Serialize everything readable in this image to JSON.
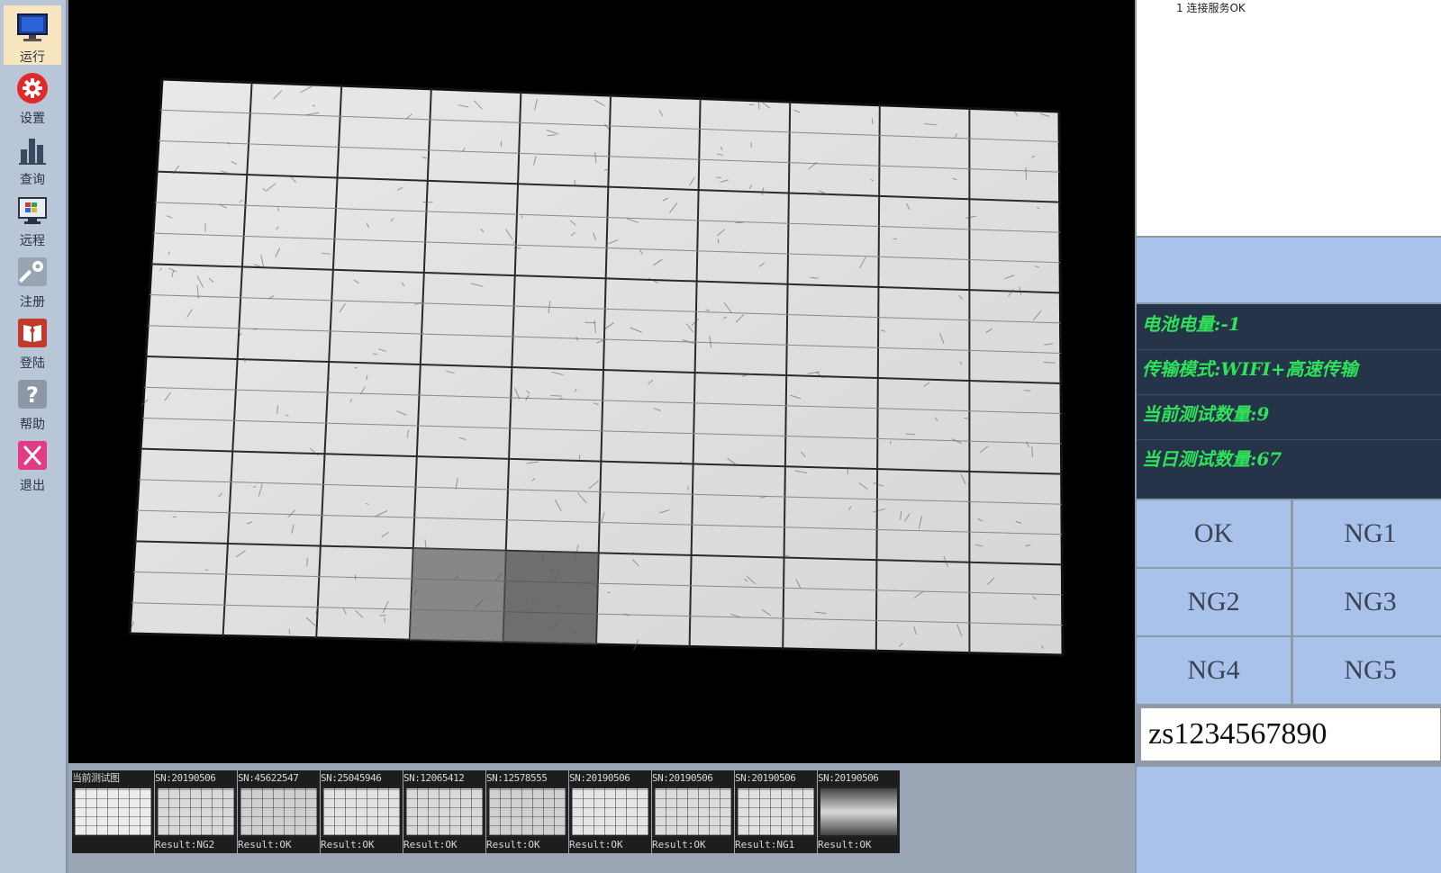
{
  "sidebar": {
    "items": [
      {
        "label": "运行",
        "icon": "monitor-icon",
        "active": true
      },
      {
        "label": "设置",
        "icon": "gear-icon"
      },
      {
        "label": "查询",
        "icon": "bar-chart-icon"
      },
      {
        "label": "远程",
        "icon": "remote-desktop-icon"
      },
      {
        "label": "注册",
        "icon": "key-icon"
      },
      {
        "label": "登陆",
        "icon": "login-book-icon"
      },
      {
        "label": "帮助",
        "icon": "help-icon"
      },
      {
        "label": "退出",
        "icon": "exit-icon"
      }
    ]
  },
  "log": {
    "lines": [
      "1 连接服务OK"
    ]
  },
  "status": {
    "battery": "电池电量:-1",
    "transfer_mode": "传输模式:WIFI+高速传输",
    "current_count": "当前测试数量:9",
    "daily_count": "当日测试数量:67"
  },
  "result_buttons": [
    "OK",
    "NG1",
    "NG2",
    "NG3",
    "NG4",
    "NG5"
  ],
  "serial_input": {
    "value": "zs1234567890"
  },
  "thumbnails": [
    {
      "header": "当前测试图",
      "footer": ""
    },
    {
      "header": "SN:20190506",
      "footer": "Result:NG2"
    },
    {
      "header": "SN:45622547",
      "footer": "Result:OK"
    },
    {
      "header": "SN:25045946",
      "footer": "Result:OK"
    },
    {
      "header": "SN:12065412",
      "footer": "Result:OK"
    },
    {
      "header": "SN:12578555",
      "footer": "Result:OK"
    },
    {
      "header": "SN:20190506",
      "footer": "Result:OK"
    },
    {
      "header": "SN:20190506",
      "footer": "Result:OK"
    },
    {
      "header": "SN:20190506",
      "footer": "Result:NG1"
    },
    {
      "header": "SN:20190506",
      "footer": "Result:OK"
    }
  ],
  "colors": {
    "sidebar_bg": "#b9c6d8",
    "viewer_bg": "#000000",
    "status_bg": "#253449",
    "status_text": "#2fe25a",
    "button_bg": "#a9c2ea"
  }
}
